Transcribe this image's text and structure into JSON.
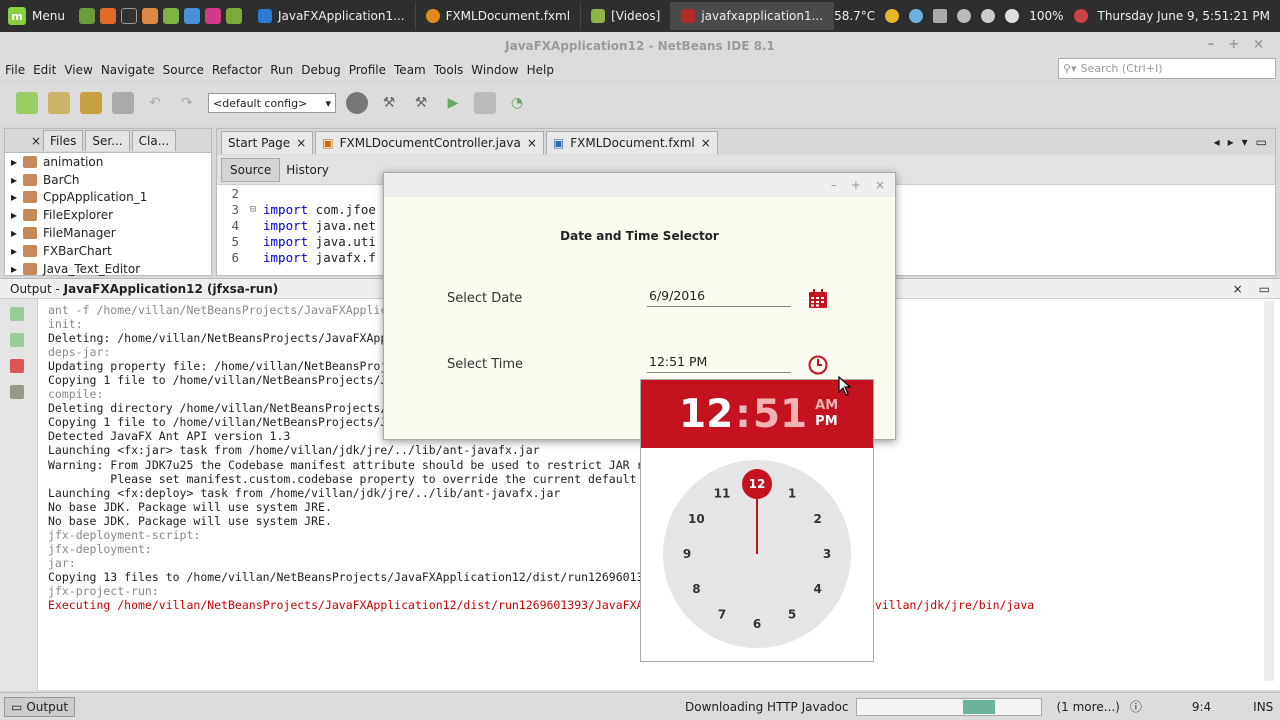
{
  "taskbar": {
    "menu_label": "Menu",
    "windows": [
      {
        "label": "JavaFXApplication1...",
        "color": "#2a7bd6"
      },
      {
        "label": "FXMLDocument.fxml",
        "color": "#e08a1e"
      },
      {
        "label": "[Videos]",
        "color": "#8fb347"
      },
      {
        "label": "javafxapplication1...",
        "color": "#b52a2a"
      }
    ],
    "temp": "58.7°C",
    "battery": "100%",
    "datetime": "Thursday June  9,  5:51:21 PM"
  },
  "window": {
    "title": "JavaFXApplication12 - NetBeans IDE 8.1"
  },
  "menu": [
    "File",
    "Edit",
    "View",
    "Navigate",
    "Source",
    "Refactor",
    "Run",
    "Debug",
    "Profile",
    "Team",
    "Tools",
    "Window",
    "Help"
  ],
  "search": {
    "placeholder": "Search (Ctrl+I)"
  },
  "toolbar": {
    "config": "<default config>"
  },
  "projects": {
    "tabs": [
      "Files",
      "Ser...",
      "Cla..."
    ],
    "items": [
      "animation",
      "BarCh",
      "CppApplication_1",
      "FileExplorer",
      "FileManager",
      "FXBarChart",
      "Java_Text_Editor"
    ]
  },
  "editor": {
    "tabs": [
      "Start Page",
      "FXMLDocumentController.java",
      "FXMLDocument.fxml"
    ],
    "source_label": "Source",
    "history_label": "History",
    "lines": [
      {
        "n": "2",
        "kw": "",
        "code": ""
      },
      {
        "n": "3",
        "kw": "import",
        "code": " com.jfoe"
      },
      {
        "n": "4",
        "kw": "import",
        "code": " java.net"
      },
      {
        "n": "5",
        "kw": "import",
        "code": " java.uti"
      },
      {
        "n": "6",
        "kw": "import",
        "code": " javafx.f"
      }
    ]
  },
  "output": {
    "title_prefix": "Output - ",
    "title": "JavaFXApplication12 (jfxsa-run)",
    "lines": [
      {
        "t": "ant -f /home/villan/NetBeansProjects/JavaFXApplicat",
        "c": "gray"
      },
      {
        "t": "init:",
        "c": "gray"
      },
      {
        "t": "Deleting: /home/villan/NetBeansProjects/JavaFXAppli",
        "c": ""
      },
      {
        "t": "deps-jar:",
        "c": "gray"
      },
      {
        "t": "Updating property file: /home/villan/NetBeansProjec",
        "c": ""
      },
      {
        "t": "Copying 1 file to /home/villan/NetBeansProjects/Jav",
        "c": ""
      },
      {
        "t": "compile:",
        "c": "gray"
      },
      {
        "t": "Deleting directory /home/villan/NetBeansProjects/Ja",
        "c": ""
      },
      {
        "t": "Copying 1 file to /home/villan/NetBeansProjects/Jav",
        "c": ""
      },
      {
        "t": "Detected JavaFX Ant API version 1.3",
        "c": ""
      },
      {
        "t": "Launching <fx:jar> task from /home/villan/jdk/jre/../lib/ant-javafx.jar",
        "c": ""
      },
      {
        "t": "Warning: From JDK7u25 the Codebase manifest attribute should be used to restrict JAR repurp",
        "c": ""
      },
      {
        "t": "         Please set manifest.custom.codebase property to override the current default non-s",
        "c": ""
      },
      {
        "t": "Launching <fx:deploy> task from /home/villan/jdk/jre/../lib/ant-javafx.jar",
        "c": ""
      },
      {
        "t": "No base JDK. Package will use system JRE.",
        "c": ""
      },
      {
        "t": "No base JDK. Package will use system JRE.",
        "c": ""
      },
      {
        "t": "jfx-deployment-script:",
        "c": "gray"
      },
      {
        "t": "jfx-deployment:",
        "c": "gray"
      },
      {
        "t": "jar:",
        "c": "gray"
      },
      {
        "t": "Copying 13 files to /home/villan/NetBeansProjects/JavaFXApplication12/dist/run1269601393",
        "c": ""
      },
      {
        "t": "jfx-project-run:",
        "c": "gray"
      },
      {
        "t": "Executing /home/villan/NetBeansProjects/JavaFXApplication12/dist/run1269601393/JavaFXAppli",
        "c": "red"
      }
    ],
    "tail": "nvillan/jdk/jre/bin/java"
  },
  "status": {
    "output_label": "Output",
    "downloading": "Downloading HTTP Javadoc",
    "progress": 0.2,
    "more": "(1 more...)",
    "position": "9:4",
    "mode": "INS"
  },
  "dialog": {
    "title": "Date and Time Selector",
    "date_label": "Select Date",
    "date_value": "6/9/2016",
    "time_label": "Select Time",
    "time_value": "12:51 PM"
  },
  "clock": {
    "hour": "12",
    "colon": ":",
    "minute": "51",
    "am": "AM",
    "pm": "PM",
    "accent": "#c4121f",
    "numbers": [
      "12",
      "1",
      "2",
      "3",
      "4",
      "5",
      "6",
      "7",
      "8",
      "9",
      "10",
      "11"
    ]
  }
}
